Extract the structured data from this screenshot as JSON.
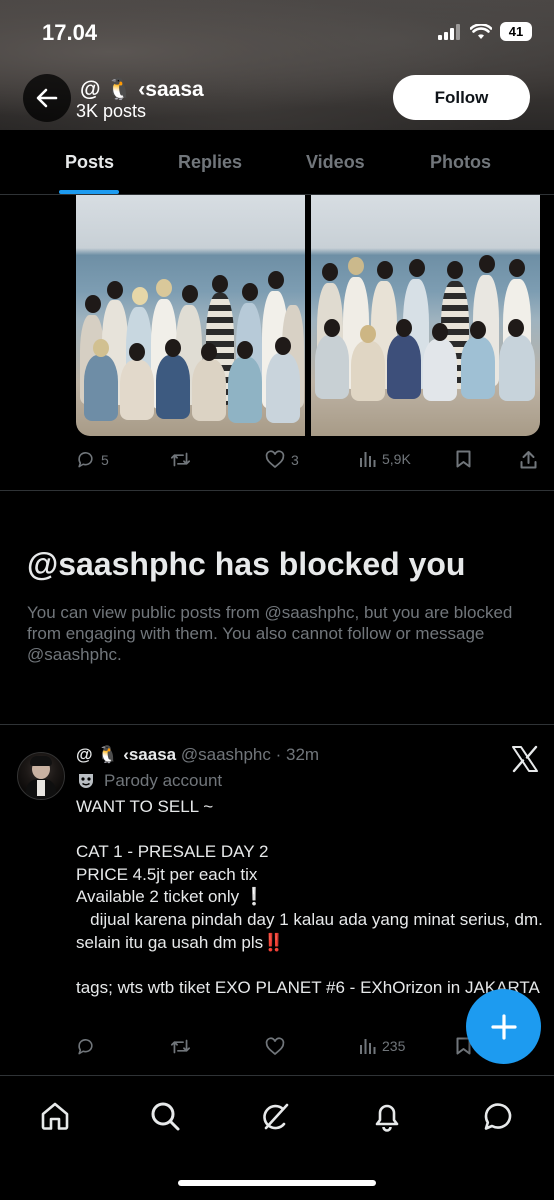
{
  "status_bar": {
    "time": "17.04",
    "battery": "41"
  },
  "profile": {
    "display_name": "@ 🐧 ‹saasa",
    "post_count": "3K posts",
    "follow_label": "Follow"
  },
  "tabs": [
    {
      "label": "Posts",
      "active": true
    },
    {
      "label": "Replies",
      "active": false
    },
    {
      "label": "Videos",
      "active": false
    },
    {
      "label": "Photos",
      "active": false
    }
  ],
  "media_post": {
    "stats": {
      "replies": "5",
      "reposts": "",
      "likes": "3",
      "views": "5,9K"
    }
  },
  "blocked_notice": {
    "title": "@saashphc has blocked you",
    "text": "You can view public posts from @saashphc, but you are blocked from engaging with them. You also cannot follow or message @saashphc."
  },
  "tweet": {
    "display_name": "@ 🐧 ‹saasa",
    "handle_time": "@saashphc · 32m",
    "parody_label": "Parody account",
    "lines": [
      "WANT TO SELL  ~",
      "",
      "CAT 1 - PRESALE  DAY 2",
      "PRICE 4.5jt per each tix",
      "Available 2 ticket only  ❕",
      "   dijual karena pindah day 1 kalau ada yang minat serius, dm. selain itu ga usah dm pls‼️",
      "",
      "tags; wts wtb tiket EXO PLANET #6 - EXhOrizon in JAKARTA"
    ],
    "stats": {
      "views": "235"
    }
  },
  "icons": {
    "back": "back-arrow-icon",
    "reply": "reply-icon",
    "repost": "repost-icon",
    "like": "heart-icon",
    "views": "views-icon",
    "bookmark": "bookmark-icon",
    "share": "share-icon",
    "x_logo": "x-logo-icon",
    "compose": "plus-icon",
    "home": "home-icon",
    "search": "search-icon",
    "grok": "grok-icon",
    "notifications": "bell-icon",
    "messages": "message-icon"
  },
  "colors": {
    "accent": "#1d9bf0",
    "text": "#e7e9ea",
    "secondary": "#71767b",
    "background": "#000000"
  }
}
